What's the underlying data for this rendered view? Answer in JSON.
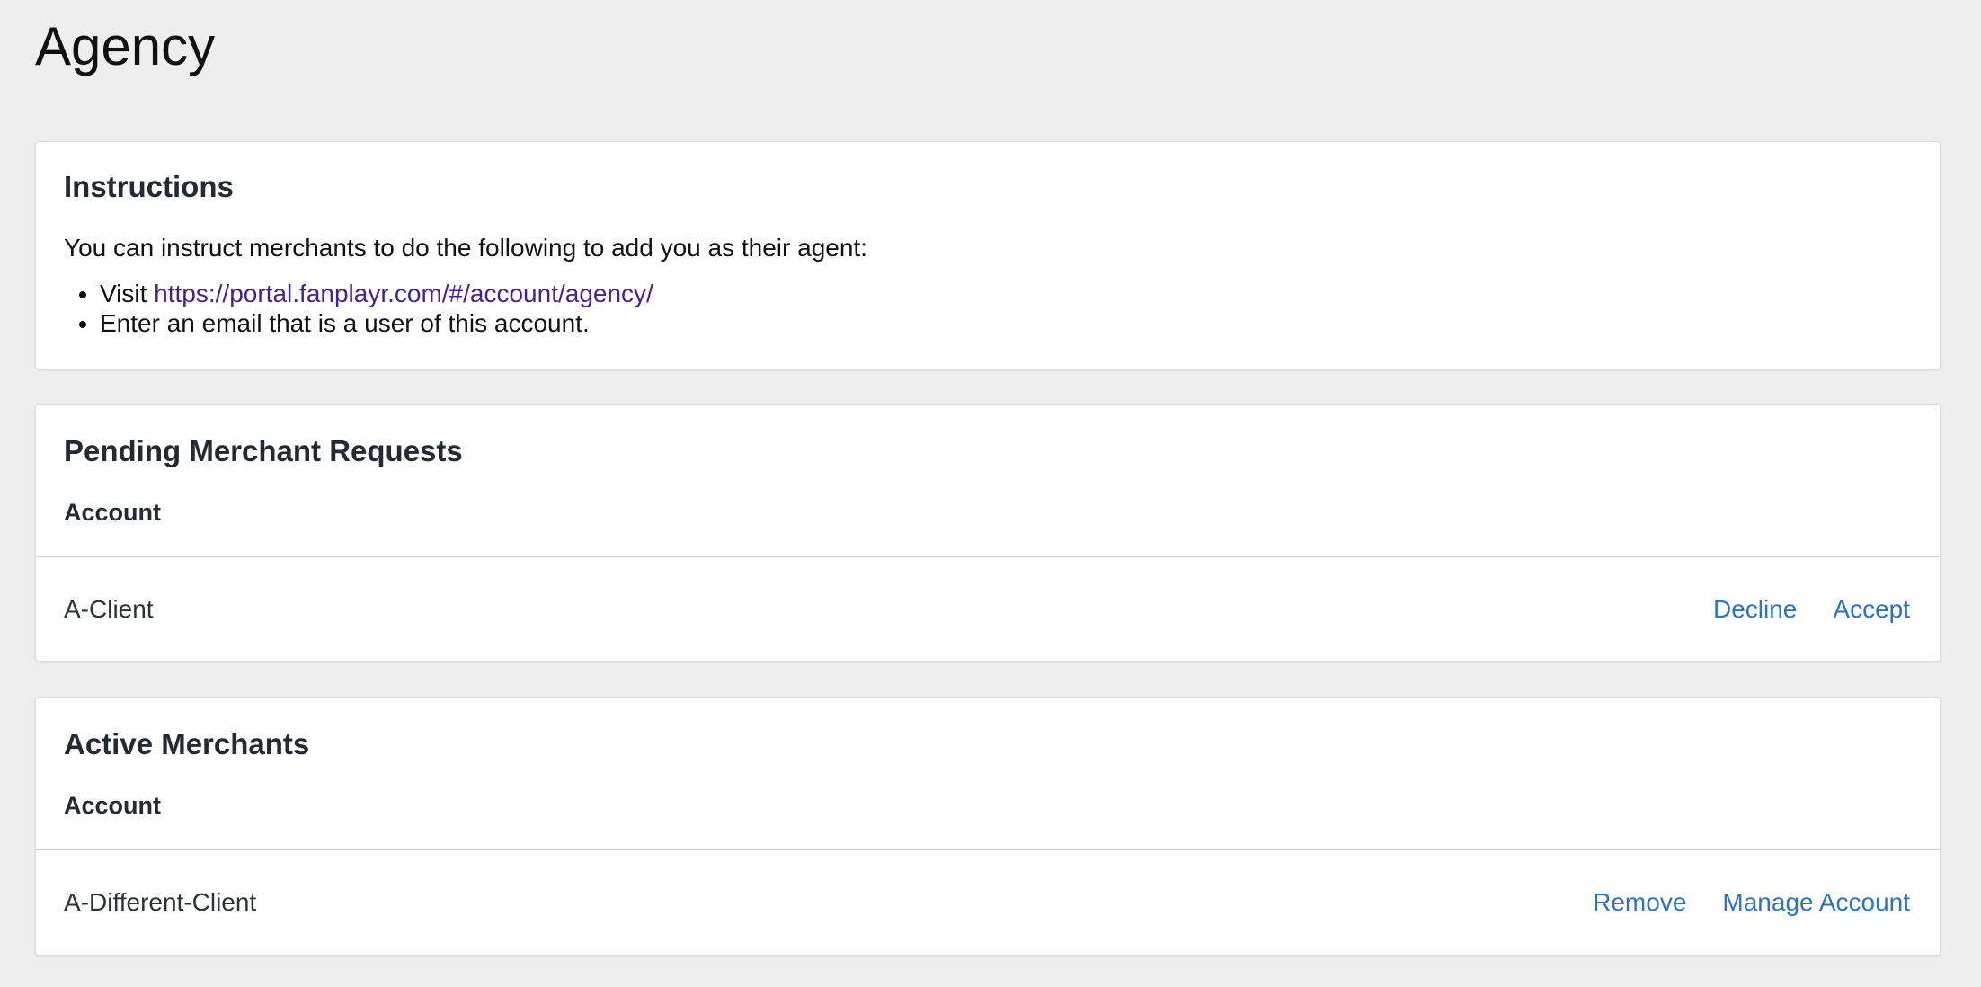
{
  "page": {
    "title": "Agency"
  },
  "instructions": {
    "title": "Instructions",
    "intro": "You can instruct merchants to do the following to add you as their agent:",
    "step1_prefix": "Visit ",
    "step1_link": "https://portal.fanplayr.com/#/account/agency/",
    "step2": "Enter an email that is a user of this account."
  },
  "pending": {
    "title": "Pending Merchant Requests",
    "column_header": "Account",
    "rows": [
      {
        "account": "A-Client",
        "decline_label": "Decline",
        "accept_label": "Accept"
      }
    ]
  },
  "active": {
    "title": "Active Merchants",
    "column_header": "Account",
    "rows": [
      {
        "account": "A-Different-Client",
        "remove_label": "Remove",
        "manage_label": "Manage Account"
      }
    ]
  },
  "colors": {
    "background": "#eeeeee",
    "link": "#2f72bf",
    "visited_link": "#4a1f92"
  }
}
